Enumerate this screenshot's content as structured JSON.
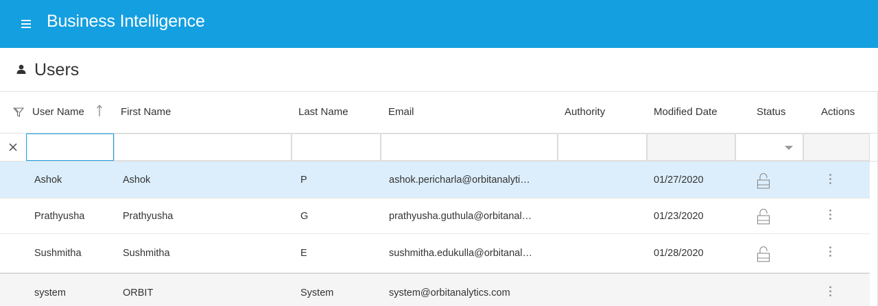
{
  "app": {
    "title": "Business Intelligence"
  },
  "page": {
    "title": "Users"
  },
  "columns": [
    {
      "key": "username",
      "label": "User Name"
    },
    {
      "key": "first_name",
      "label": "First Name"
    },
    {
      "key": "last_name",
      "label": "Last Name"
    },
    {
      "key": "email",
      "label": "Email"
    },
    {
      "key": "authority",
      "label": "Authority"
    },
    {
      "key": "modified_date",
      "label": "Modified Date"
    },
    {
      "key": "status",
      "label": "Status"
    },
    {
      "key": "actions",
      "label": "Actions"
    }
  ],
  "sort": {
    "column": "username",
    "direction": "ascending"
  },
  "filters": {
    "username": "",
    "first_name": "",
    "last_name": "",
    "email": "",
    "authority": "",
    "status": ""
  },
  "rows": [
    {
      "username": "Ashok",
      "first_name": "Ashok",
      "last_name": "P",
      "email": "ashok.pericharla@orbitanalyti…",
      "authority": "",
      "modified_date": "01/27/2020",
      "status_icon": "unlocked-padlock-icon",
      "selected": true
    },
    {
      "username": "Prathyusha",
      "first_name": "Prathyusha",
      "last_name": "G",
      "email": "prathyusha.guthula@orbitanal…",
      "authority": "",
      "modified_date": "01/23/2020",
      "status_icon": "unlocked-padlock-icon",
      "selected": false
    },
    {
      "username": "Sushmitha",
      "first_name": "Sushmitha",
      "last_name": "E",
      "email": "sushmitha.edukulla@orbitanal…",
      "authority": "",
      "modified_date": "01/28/2020",
      "status_icon": "unlocked-padlock-icon",
      "selected": false
    },
    {
      "username": "system",
      "first_name": "ORBIT",
      "last_name": "System",
      "email": "system@orbitanalytics.com",
      "authority": "",
      "modified_date": "",
      "status_icon": "",
      "selected": false
    }
  ],
  "colors": {
    "brand": "#149fe0",
    "selected_row": "#dceefb",
    "system_row": "#f5f5f5"
  }
}
